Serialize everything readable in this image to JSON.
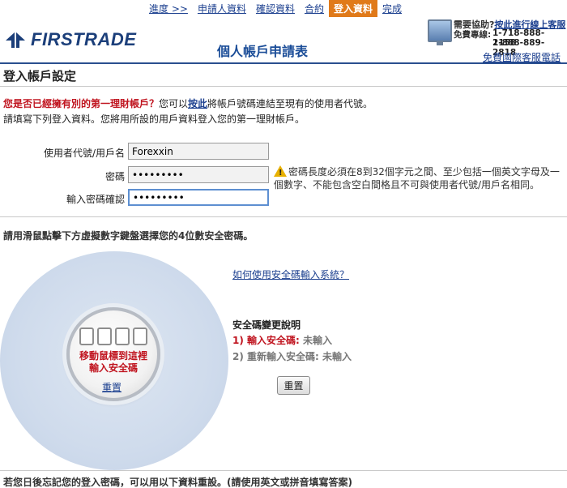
{
  "nav": {
    "items": [
      {
        "label": "進度 >>",
        "active": false
      },
      {
        "label": "申請人資料",
        "active": false
      },
      {
        "label": "確認資料",
        "active": false
      },
      {
        "label": "合約",
        "active": false
      },
      {
        "label": "登入資料",
        "active": true
      },
      {
        "label": "完成",
        "active": false
      }
    ]
  },
  "logo": {
    "text": "FIRSTRADE"
  },
  "header": {
    "form_title": "個人帳戶申請表"
  },
  "help": {
    "question": "需要協助?",
    "live_chat_link": "按此進行線上客服",
    "tollfree_label": "免費專線:",
    "phone1": "1-718-888-2158",
    "phone2": "1-888-889-2818",
    "intl_link": "免費國際客服電話"
  },
  "section": {
    "title": "登入帳戶設定"
  },
  "intro": {
    "question": "您是否已經擁有別的第一理財帳戶？",
    "part2": "您可以",
    "link": "按此",
    "part3": "將帳戶號碼連結至現有的使用者代號。",
    "line2": "請填寫下列登入資料。您將用所設的用戶資料登入您的第一理財帳戶。"
  },
  "form": {
    "username_label": "使用者代號/用戶名",
    "username_value": "Forexxin",
    "password_label": "密碼",
    "password_value": "•••••••••",
    "confirm_label": "輸入密碼確認",
    "confirm_value": "•••••••••"
  },
  "warning": {
    "text": "密碼長度必須在8到32個字元之間、至少包括一個英文字母及一個數字、不能包含空白間格且不可與使用者代號/用戶名相同。"
  },
  "keypad": {
    "instruction": "請用滑鼠點擊下方虛擬數字鍵盤選擇您的4位數安全密碼。",
    "move_here_line1": "移動鼠標到這裡",
    "move_here_line2": "輸入安全碼",
    "reset_link": "重置"
  },
  "security": {
    "how_link": "如何使用安全碼輸入系統？",
    "change_title": "安全碼變更說明",
    "step1_label": "1) 輸入安全碼:",
    "step1_status": "未輸入",
    "step2_label": "2) 重新輸入安全碼:",
    "step2_status": "未輸入",
    "reset_button": "重置"
  },
  "footer": {
    "text": "若您日後忘記您的登入密碼，可以用以下資料重設。(請使用英文或拼音填寫答案)"
  },
  "colors": {
    "brand_blue": "#1c3f7a",
    "accent_orange": "#e07a1a",
    "alert_red": "#c0141f",
    "link_blue": "#1b3f8f"
  }
}
